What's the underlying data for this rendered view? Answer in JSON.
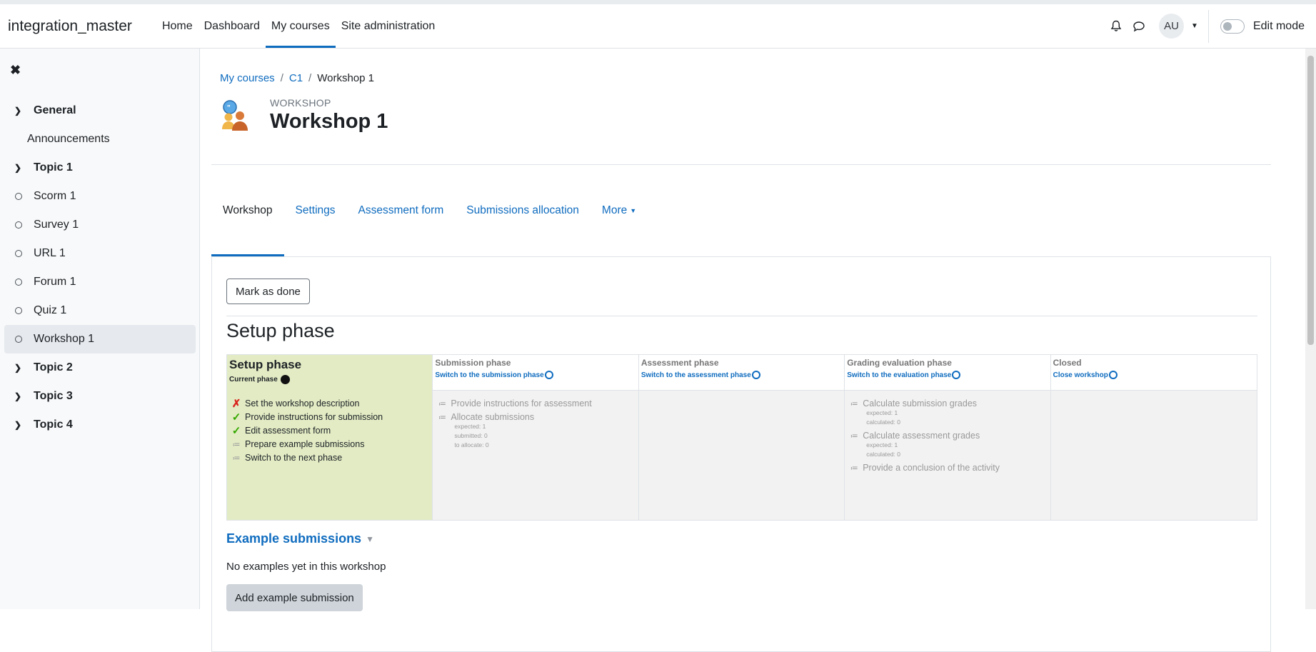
{
  "navbar": {
    "brand": "integration_master",
    "items": [
      {
        "label": "Home"
      },
      {
        "label": "Dashboard"
      },
      {
        "label": "My courses"
      },
      {
        "label": "Site administration"
      }
    ],
    "active_item": "My courses",
    "avatar_initials": "AU",
    "edit_mode_label": "Edit mode",
    "edit_mode_on": false
  },
  "sidebar": {
    "close_icon": "close-icon",
    "sections": [
      {
        "label": "General"
      },
      {
        "label": "Announcements"
      },
      {
        "label": "Topic 1"
      },
      {
        "label": "Scorm 1"
      },
      {
        "label": "Survey 1"
      },
      {
        "label": "URL 1"
      },
      {
        "label": "Forum 1"
      },
      {
        "label": "Quiz 1"
      },
      {
        "label": "Workshop 1"
      },
      {
        "label": "Topic 2"
      },
      {
        "label": "Topic 3"
      },
      {
        "label": "Topic 4"
      }
    ],
    "current": "Workshop 1"
  },
  "breadcrumb": {
    "items": [
      "My courses",
      "C1",
      "Workshop 1"
    ]
  },
  "header": {
    "module_type": "WORKSHOP",
    "title": "Workshop 1"
  },
  "tabs": {
    "items": [
      "Workshop",
      "Settings",
      "Assessment form",
      "Submissions allocation",
      "More"
    ],
    "active": "Workshop"
  },
  "content": {
    "mark_done_label": "Mark as done",
    "phase_heading": "Setup phase",
    "phases": [
      {
        "title": "Setup phase",
        "current_label": "Current phase",
        "tasks": [
          {
            "label": "Set the workshop description",
            "status": "fail"
          },
          {
            "label": "Provide instructions for submission",
            "status": "done"
          },
          {
            "label": "Edit assessment form",
            "status": "done"
          },
          {
            "label": "Prepare example submissions",
            "status": "todo"
          },
          {
            "label": "Switch to the next phase",
            "status": "todo"
          }
        ]
      },
      {
        "title": "Submission phase",
        "action": "Switch to the submission phase",
        "tasks": [
          {
            "label": "Provide instructions for assessment",
            "status": "todo"
          },
          {
            "label": "Allocate submissions",
            "status": "todo",
            "details": [
              "expected: 1",
              "submitted: 0",
              "to allocate: 0"
            ]
          }
        ]
      },
      {
        "title": "Assessment phase",
        "action": "Switch to the assessment phase",
        "tasks": []
      },
      {
        "title": "Grading evaluation phase",
        "action": "Switch to the evaluation phase",
        "tasks": [
          {
            "label": "Calculate submission grades",
            "status": "todo",
            "details": [
              "expected: 1",
              "calculated: 0"
            ]
          },
          {
            "label": "Calculate assessment grades",
            "status": "todo",
            "details": [
              "expected: 1",
              "calculated: 0"
            ]
          },
          {
            "label": "Provide a conclusion of the activity",
            "status": "todo"
          }
        ]
      },
      {
        "title": "Closed",
        "action": "Close workshop",
        "tasks": []
      }
    ],
    "examples_heading": "Example submissions",
    "no_examples": "No examples yet in this workshop",
    "add_example_label": "Add example submission"
  }
}
